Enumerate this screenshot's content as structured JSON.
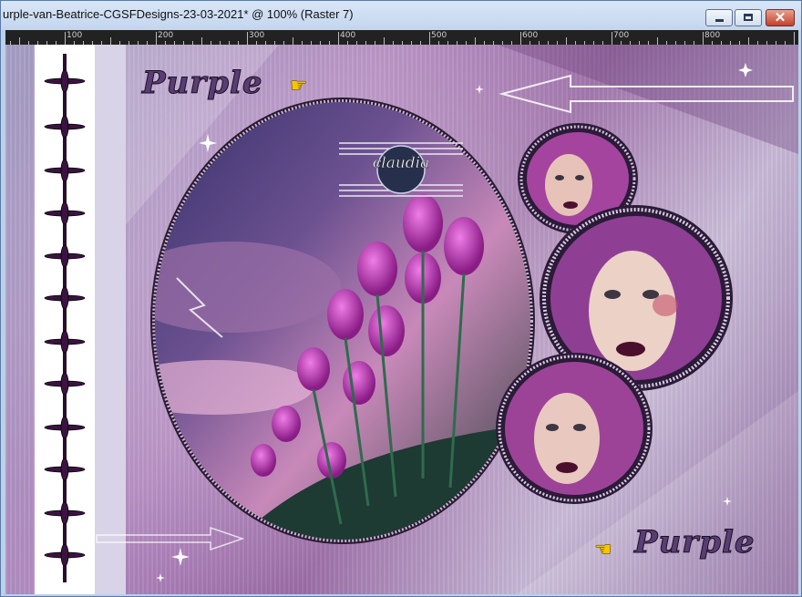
{
  "window": {
    "title": "urple-van-Beatrice-CGSFDesigns-23-03-2021* @ 100% (Raster 7)",
    "controls": {
      "minimize": "minimize",
      "maximize": "maximize",
      "close": "✕"
    }
  },
  "ruler": {
    "labels": [
      "100",
      "200",
      "300",
      "400",
      "500",
      "600",
      "700",
      "800"
    ]
  },
  "canvas": {
    "wordmark_top": "Purple",
    "wordmark_bottom": "Purple",
    "badge_text": "claudia",
    "icons": [
      "pointing-hand-icon",
      "pointing-hand-icon",
      "left-arrow-icon",
      "right-arrow-icon"
    ],
    "colors": {
      "accent": "#b14ac1",
      "frame": "#2b1b38",
      "background": "#a78bc1"
    }
  }
}
